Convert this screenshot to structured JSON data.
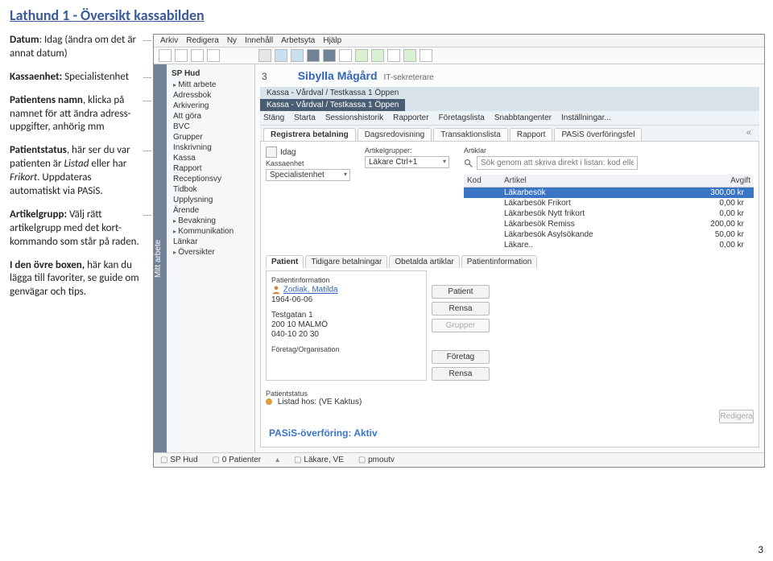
{
  "document": {
    "title": "Lathund 1 - Översikt kassabilden",
    "page_number": "3"
  },
  "notes": {
    "n1a": "Datum",
    "n1b": ": Idag (ändra om det är annat datum)",
    "n2a": "Kassaenhet:",
    "n2b": " Specialistenhet",
    "n3a": "Patientens namn",
    "n3b": ", klicka på namnet för att ändra adress-uppgifter, anhörig mm",
    "n4a": "Patientstatus",
    "n4b": ", här ser du var patienten är ",
    "n4c": "Listad",
    "n4d": " eller har ",
    "n4e": "Frikort",
    "n4f": ". Uppdateras automatiskt via PASiS.",
    "n5a": "Artikelgrupp:",
    "n5b": " Välj rätt artikelgrupp med det kort-kommando som står på raden.",
    "n6a": "I den övre boxen,",
    "n6b": "  här kan du lägga till favoriter, se guide om genvägar och tips."
  },
  "app": {
    "menu": [
      "Arkiv",
      "Redigera",
      "Ny",
      "Innehåll",
      "Arbetsyta",
      "Hjälp"
    ],
    "vstrip": "Mitt arbete",
    "sidebar_head": "SP Hud",
    "sidebar": [
      {
        "label": "Mitt arbete",
        "exp": true
      },
      {
        "label": "Adressbok"
      },
      {
        "label": "Arkivering"
      },
      {
        "label": "Att göra"
      },
      {
        "label": "BVC"
      },
      {
        "label": "Grupper"
      },
      {
        "label": "Inskrivning"
      },
      {
        "label": "Kassa"
      },
      {
        "label": "Rapport"
      },
      {
        "label": "Receptionsvy"
      },
      {
        "label": "Tidbok"
      },
      {
        "label": "Upplysning"
      },
      {
        "label": "Ärende"
      },
      {
        "label": "Bevakning",
        "exp": true
      },
      {
        "label": "Kommunikation",
        "exp": true
      },
      {
        "label": "Länkar"
      },
      {
        "label": "Översikter",
        "exp": true
      }
    ],
    "patient_name": "Sibylla Mågård",
    "patient_role": "IT-sekreterare",
    "three": "3",
    "worktabs": [
      {
        "label": "Kassa - Vårdval / Testkassa 1 Öppen",
        "active": false
      },
      {
        "label": "Kassa - Vårdval / Testkassa 1 Öppen",
        "active": true
      }
    ],
    "subtoolbar": [
      "Stäng",
      "Starta",
      "Sessionshistorik",
      "Rapporter",
      "Företagslista",
      "Snabbtangenter",
      "Inställningar..."
    ],
    "subtabs": [
      {
        "label": "Registrera betalning",
        "active": true
      },
      {
        "label": "Dagsredovisning"
      },
      {
        "label": "Transaktionslista"
      },
      {
        "label": "Rapport"
      },
      {
        "label": "PASiS överföringsfel"
      }
    ],
    "date_label": "Idag",
    "fields": {
      "kassaenhet_lbl": "Kassaenhet",
      "kassaenhet_val": "Specialistenhet",
      "artikelgrupper_lbl": "Artikelgrupper:",
      "artikelgrupper_val": "Läkare Ctrl+1",
      "artiklar_lbl": "Artiklar",
      "search_placeholder": "Sök genom att skriva direkt i listan: kod eller del av namn"
    },
    "artik_cols": [
      "Kod",
      "Artikel",
      "Avgift"
    ],
    "artik_rows": [
      {
        "kod": "",
        "artikel": "Läkarbesök",
        "avgift": "300,00 kr",
        "sel": true
      },
      {
        "kod": "",
        "artikel": "Läkarbesök Frikort",
        "avgift": "0,00 kr"
      },
      {
        "kod": "",
        "artikel": "Läkarbesök Nytt frikort",
        "avgift": "0,00 kr"
      },
      {
        "kod": "",
        "artikel": "Läkarbesök Remiss",
        "avgift": "200,00 kr"
      },
      {
        "kod": "",
        "artikel": "Läkarbesök Asylsökande",
        "avgift": "50,00 kr"
      },
      {
        "kod": "",
        "artikel": "Läkare..",
        "avgift": "0,00 kr"
      }
    ],
    "ptabs": [
      {
        "label": "Patient",
        "active": true
      },
      {
        "label": "Tidigare betalningar"
      },
      {
        "label": "Obetalda artiklar"
      },
      {
        "label": "Patientinformation"
      }
    ],
    "pinfo": {
      "head": "Patientinformation",
      "name": "Zodiak, Matilda",
      "dob": "1964-06-06",
      "addr1": "Testgatan 1",
      "addr2": "200 10   MALMÖ",
      "phone": "040-10 20 30",
      "company_lbl": "Företag/Organisation"
    },
    "buttons": {
      "patient": "Patient",
      "rensa": "Rensa",
      "grupper": "Grupper",
      "foretag": "Företag",
      "redigera": "Redigera"
    },
    "status_head": "Patientstatus",
    "status_text": "Listad hos: (VE Kaktus)",
    "pasis": "PASiS-överföring: Aktiv",
    "statusbar": {
      "a": "SP Hud",
      "b": "0 Patienter",
      "c": "Läkare, VE",
      "d": "pmoutv"
    }
  }
}
